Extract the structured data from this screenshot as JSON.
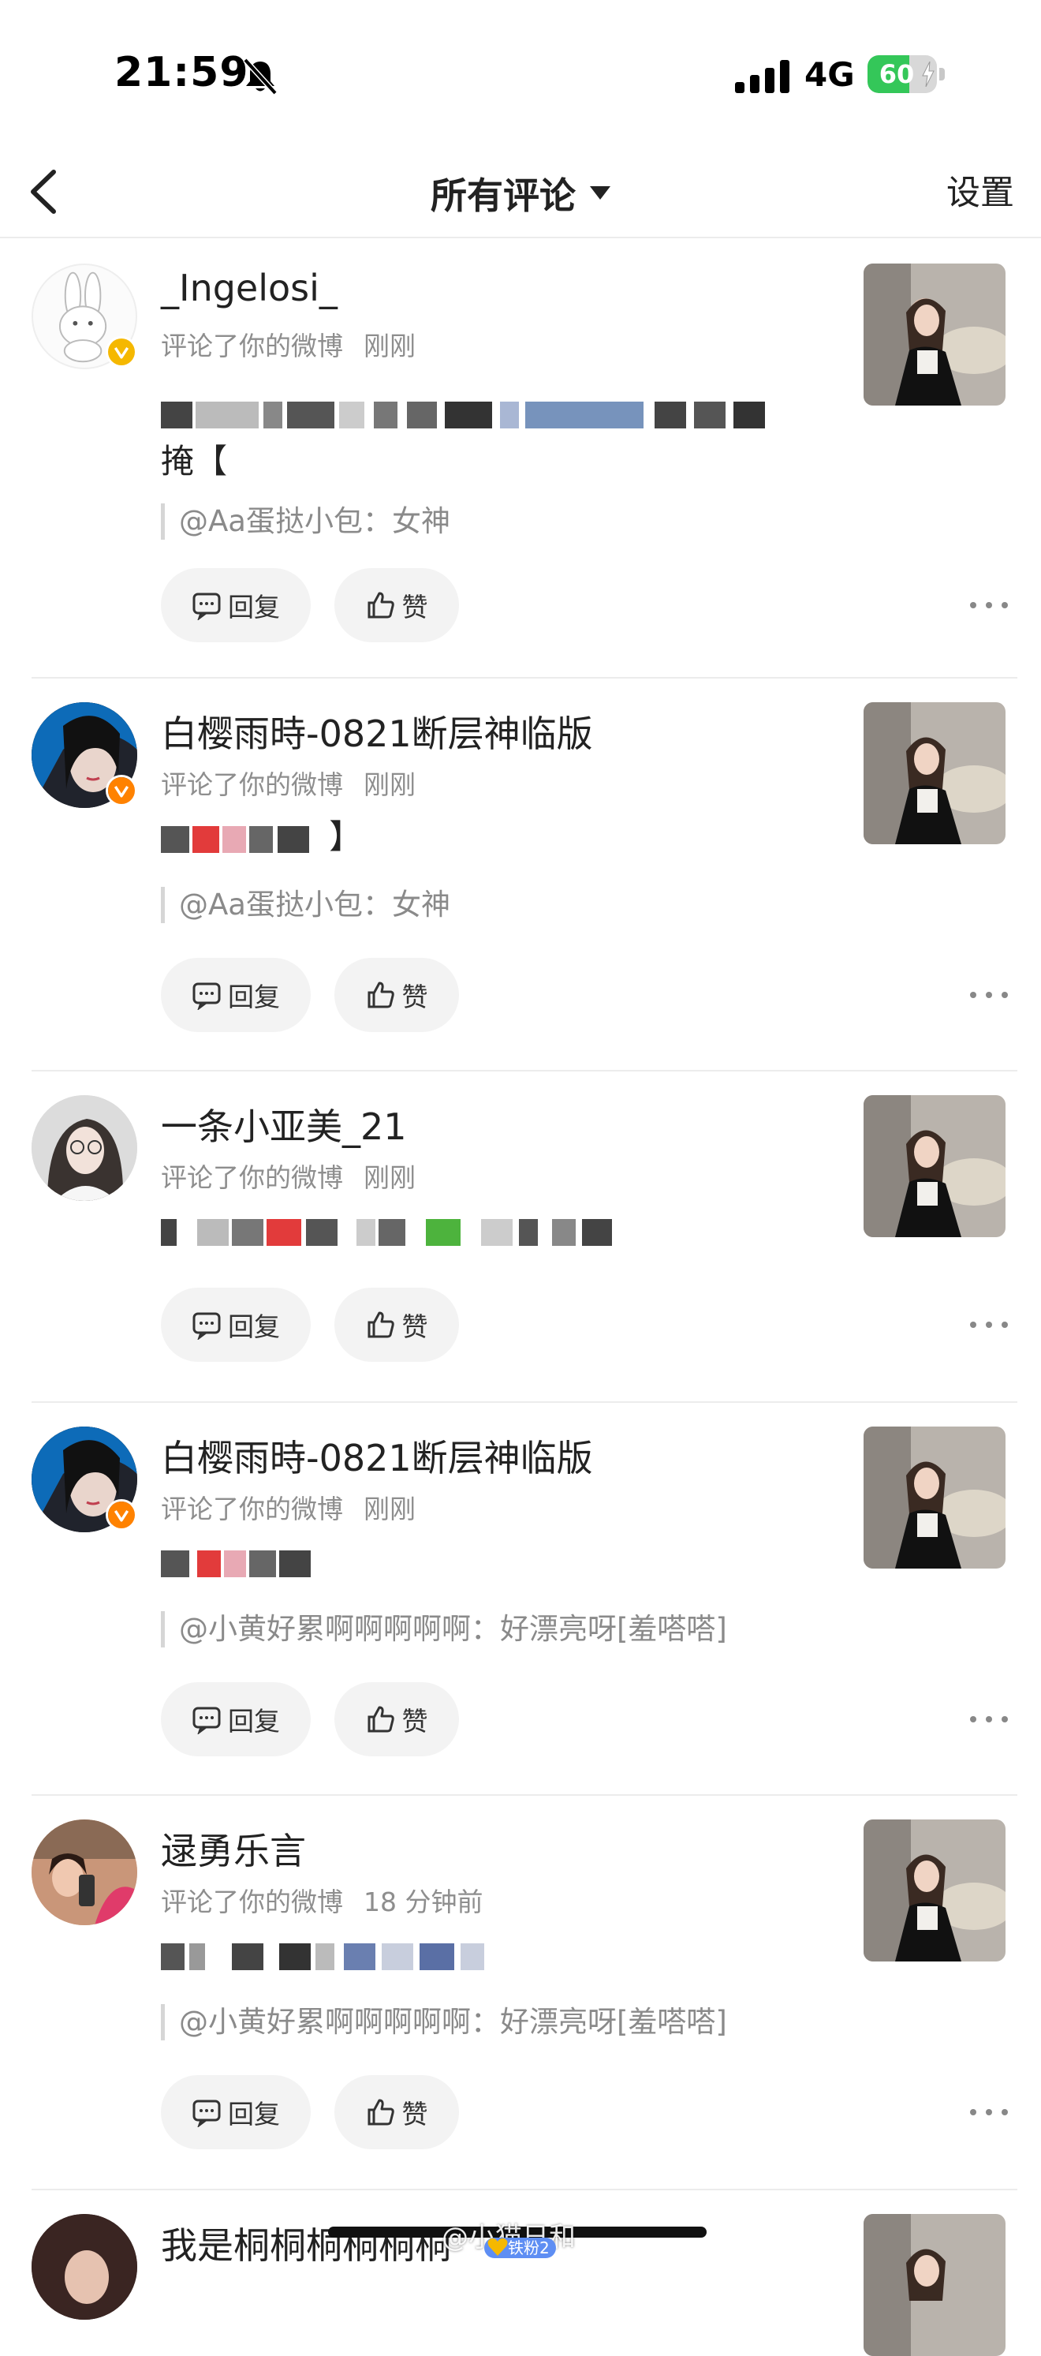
{
  "status_bar": {
    "time": "21:59",
    "network": "4G",
    "battery_percent": "60",
    "battery_level": 0.6,
    "icons": [
      "bell-off-icon",
      "signal-icon",
      "battery-icon",
      "bolt-icon"
    ]
  },
  "nav": {
    "title": "所有评论",
    "settings_label": "设置",
    "icons": [
      "back-chevron-icon",
      "caret-down-icon"
    ]
  },
  "comments": [
    {
      "user_name": "_Ingelosi_",
      "action_text": "评论了你的微博",
      "time": "刚刚",
      "content_suffix": "掩【",
      "quote": "@Aa蛋挞小包：女神",
      "reply_label": "回复",
      "like_label": "赞",
      "verified": "gold"
    },
    {
      "user_name": "白樱雨時-0821断层神临版",
      "action_text": "评论了你的微博",
      "time": "刚刚",
      "content_suffix": "】",
      "quote": "@Aa蛋挞小包：女神",
      "reply_label": "回复",
      "like_label": "赞",
      "verified": "orange"
    },
    {
      "user_name": "一条小亚美_21",
      "action_text": "评论了你的微博",
      "time": "刚刚",
      "reply_label": "回复",
      "like_label": "赞"
    },
    {
      "user_name": "白樱雨時-0821断层神临版",
      "action_text": "评论了你的微博",
      "time": "刚刚",
      "quote": "@小黄好累啊啊啊啊啊：好漂亮呀[羞嗒嗒]",
      "reply_label": "回复",
      "like_label": "赞",
      "verified": "orange"
    },
    {
      "user_name": "逯勇乐言",
      "action_text": "评论了你的微博",
      "time": "18 分钟前",
      "quote": "@小黄好累啊啊啊啊啊：好漂亮呀[羞嗒嗒]",
      "reply_label": "回复",
      "like_label": "赞"
    },
    {
      "user_name": "我是桐桐桐桐桐桐"
    }
  ],
  "colors": {
    "accent_orange": "#ff8200",
    "verified_gold": "#f5b800",
    "link_blue": "#4a6fa5",
    "meta_gray": "#8e8e8e",
    "battery_green": "#34c759"
  },
  "watermark": {
    "text": "@小猫日和",
    "badge": "铁粉2"
  }
}
